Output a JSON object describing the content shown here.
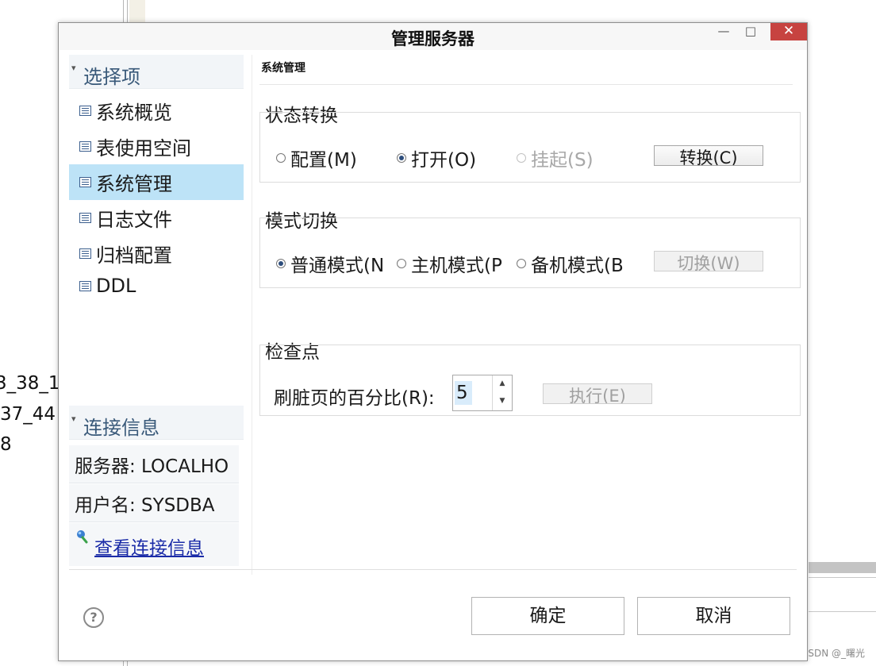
{
  "background": {
    "fragment_lines": [
      "3_38_1",
      "37_44",
      "8"
    ],
    "watermark": "CSDN @_曙光"
  },
  "dialog": {
    "title": "管理服务器",
    "window_controls": {
      "minimize": "—",
      "maximize": "□",
      "close": "✕"
    }
  },
  "sidebar": {
    "options_header": "选择项",
    "items": [
      {
        "label": "系统概览",
        "selected": false
      },
      {
        "label": "表使用空间",
        "selected": false
      },
      {
        "label": "系统管理",
        "selected": true
      },
      {
        "label": "日志文件",
        "selected": false
      },
      {
        "label": "归档配置",
        "selected": false
      },
      {
        "label": "DDL",
        "selected": false
      }
    ],
    "connection_header": "连接信息",
    "server_text": "服务器: LOCALHO",
    "user_text": "用户名: SYSDBA",
    "view_connection_link": "查看连接信息"
  },
  "content": {
    "page_title": "系统管理",
    "state_group": {
      "title": "状态转换",
      "options": [
        {
          "label": "配置(M)",
          "checked": false,
          "disabled": false
        },
        {
          "label": "打开(O)",
          "checked": true,
          "disabled": false
        },
        {
          "label": "挂起(S)",
          "checked": false,
          "disabled": true
        }
      ],
      "button": "转换(C)"
    },
    "mode_group": {
      "title": "模式切换",
      "options": [
        {
          "label": "普通模式(N",
          "checked": true,
          "disabled": false
        },
        {
          "label": "主机模式(P",
          "checked": false,
          "disabled": false
        },
        {
          "label": "备机模式(B",
          "checked": false,
          "disabled": false
        }
      ],
      "button": "切换(W)"
    },
    "checkpoint_group": {
      "title": "检查点",
      "dirty_page_label": "刷脏页的百分比(R):",
      "dirty_page_value": "5",
      "spinner_up": "▲",
      "spinner_down": "▼",
      "button": "执行(E)"
    }
  },
  "footer": {
    "help": "?",
    "ok": "确定",
    "cancel": "取消"
  },
  "colors": {
    "selection": "#bde3f7",
    "close_button": "#c74340",
    "link": "#1b2ca8",
    "section_header_text": "#3a5a7a"
  }
}
